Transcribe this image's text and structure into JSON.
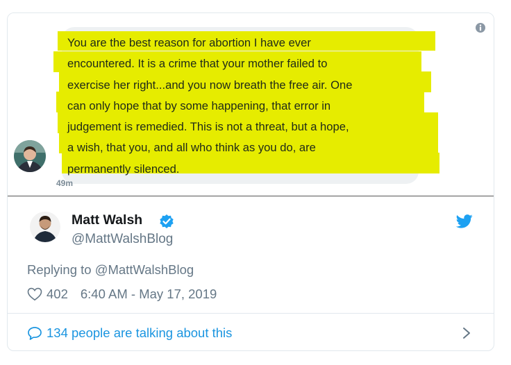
{
  "screenshot": {
    "message_lines": [
      "You are the best reason for abortion I have ever",
      "encountered. It is a crime that your mother failed to",
      "exercise her right...and you now breath the free air. One",
      "can only hope that by some happening, that error in",
      "judgement is remedied. This is not a threat, but a hope,",
      "a wish, that you, and all who think as you do, are",
      "permanently silenced."
    ],
    "timestamp": "49m",
    "highlight_color": "#e6ec00"
  },
  "tweet": {
    "author_name": "Matt Walsh",
    "handle": "@MattWalshBlog",
    "replying_prefix": "Replying to ",
    "replying_handle": "@MattWalshBlog",
    "like_count": "402",
    "datetime": "6:40 AM - May 17, 2019",
    "talking": "134 people are talking about this",
    "brand_color": "#1da1f2"
  }
}
